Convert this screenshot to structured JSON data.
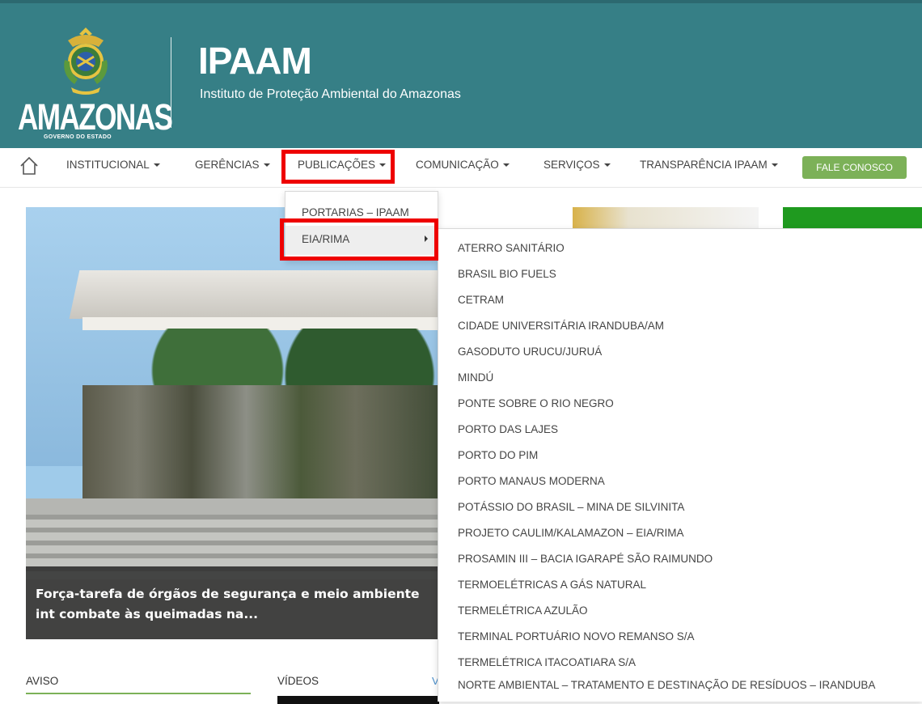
{
  "header": {
    "logo_text": "AMAZONAS",
    "logo_subtext": "GOVERNO DO ESTADO",
    "title": "IPAAM",
    "subtitle": "Instituto de Proteção Ambiental do Amazonas"
  },
  "nav": {
    "home_icon": "home-icon",
    "items": [
      {
        "label": "INSTITUCIONAL"
      },
      {
        "label": "GERÊNCIAS"
      },
      {
        "label": "PUBLICAÇÕES"
      },
      {
        "label": "COMUNICAÇÃO"
      },
      {
        "label": "SERVIÇOS"
      },
      {
        "label": "TRANSPARÊNCIA IPAAM"
      }
    ],
    "contact_button": "FALE CONOSCO",
    "contact_color": "#7cb158"
  },
  "publicacoes_menu": {
    "items": [
      {
        "label": "PORTARIAS – IPAAM"
      },
      {
        "label": "EIA/RIMA"
      }
    ]
  },
  "eia_rima_menu": {
    "items": [
      "ATERRO SANITÁRIO",
      "BRASIL BIO FUELS",
      "CETRAM",
      "CIDADE UNIVERSITÁRIA IRANDUBA/AM",
      "GASODUTO URUCU/JURUÁ",
      "MINDÚ",
      "PONTE SOBRE O RIO NEGRO",
      "PORTO DAS LAJES",
      "PORTO DO PIM",
      "PORTO MANAUS MODERNA",
      "POTÁSSIO DO BRASIL – MINA DE SILVINITA",
      "PROJETO CAULIM/KALAMAZON – EIA/RIMA",
      "PROSAMIN III – BACIA IGARAPÉ SÃO RAIMUNDO",
      "TERMOELÉTRICAS A GÁS NATURAL",
      "TERMELÉTRICA AZULÃO",
      "TERMINAL PORTUÁRIO NOVO REMANSO S/A",
      "TERMELÉTRICA ITACOATIARA S/A",
      "NORTE AMBIENTAL – TRATAMENTO E DESTINAÇÃO DE RESÍDUOS – IRANDUBA"
    ]
  },
  "hero": {
    "caption": "Força-tarefa de órgãos de segurança e meio ambiente int combate às queimadas na..."
  },
  "sections": {
    "aviso": "AVISO",
    "videos": "VÍDEOS",
    "videos_link": "V"
  },
  "colors": {
    "header_bg": "#367f86",
    "highlight": "#ee0000"
  }
}
